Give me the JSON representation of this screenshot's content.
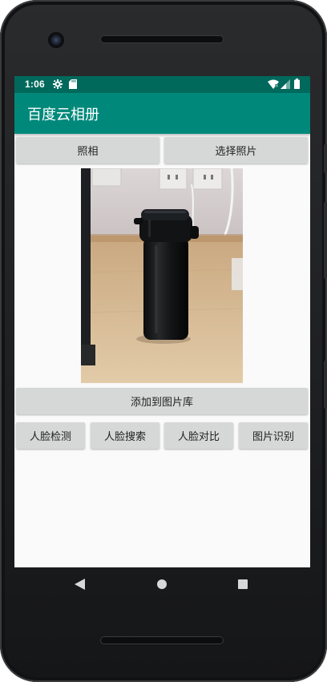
{
  "status_bar": {
    "time": "1:06",
    "icons": [
      "settings-gear-icon",
      "sd-card-icon",
      "wifi-icon",
      "cellular-signal-icon",
      "battery-icon"
    ],
    "background": "#00695c"
  },
  "app_bar": {
    "title": "百度云相册",
    "background": "#00897b"
  },
  "top_buttons": {
    "take_photo": "照相",
    "choose_photo": "选择照片"
  },
  "photo": {
    "subject": "black-thermos-bottle-photo"
  },
  "add_button": {
    "label": "添加到图片库"
  },
  "feature_buttons": [
    {
      "label": "人脸检测"
    },
    {
      "label": "人脸搜索"
    },
    {
      "label": "人脸对比"
    },
    {
      "label": "图片识别"
    }
  ],
  "nav_bar": {
    "icons": [
      "back-triangle-icon",
      "home-circle-icon",
      "recents-square-icon"
    ]
  }
}
